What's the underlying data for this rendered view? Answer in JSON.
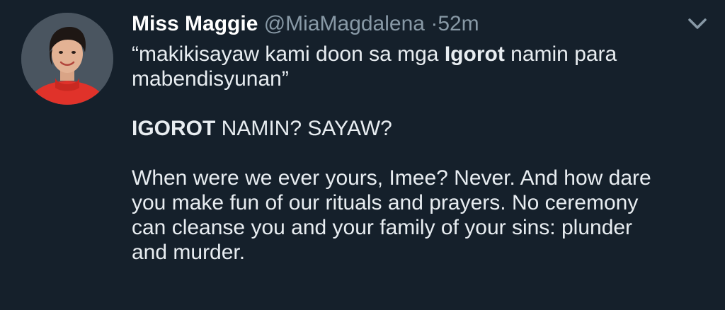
{
  "tweet": {
    "display_name": "Miss Maggie",
    "handle": "@MiaMagdalena",
    "separator": "·",
    "timestamp": "52m",
    "menu_icon": "chevron-down-icon",
    "avatar_icon": "profile-photo",
    "colors": {
      "background": "#15202b",
      "text": "#e8edf1",
      "muted": "#8899a6"
    },
    "paragraph1": {
      "part1": "“makikisayaw kami doon sa mga ",
      "bold1": "Igorot",
      "part2": " namin para",
      "line2": "mabendisyunan”"
    },
    "paragraph2": {
      "bold1": "IGOROT",
      "part1": " NAMIN? SAYAW?"
    },
    "paragraph3": {
      "line1": "When were we ever yours, Imee? Never. And how dare",
      "line2": "you make fun of our rituals and prayers. No ceremony",
      "line3": "can cleanse you and your family of your sins: plunder",
      "line4": "and murder."
    }
  }
}
